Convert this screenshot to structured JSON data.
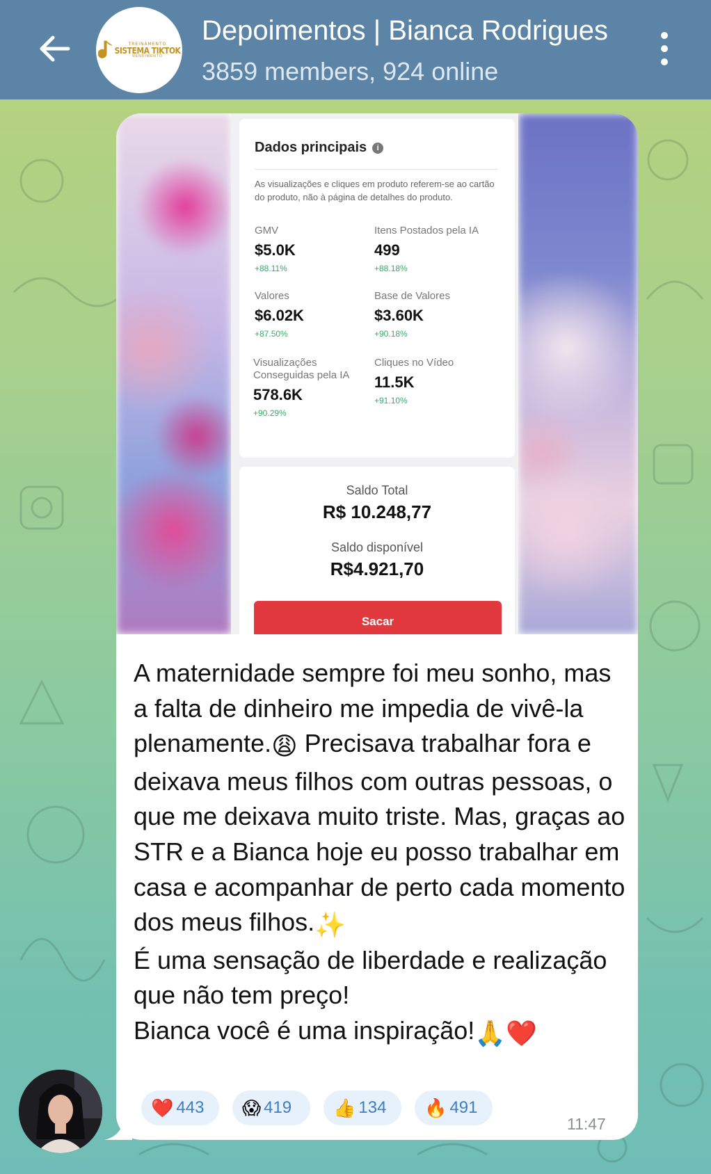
{
  "header": {
    "title": "Depoimentos | Bianca Rodrigues",
    "subtitle": "3859 members, 924 online",
    "logo_small": "TREINAMENTO",
    "logo_main": "SISTEMA TIKTOK",
    "logo_sub": "RENDIMENTO"
  },
  "media": {
    "card_title": "Dados principais",
    "card_description": "As visualizações e cliques em produto referem-se ao cartão do produto, não à página de detalhes do produto.",
    "metrics": [
      {
        "label": "GMV",
        "value": "$5.0K",
        "delta": "+88.11%"
      },
      {
        "label": "Itens Postados pela IA",
        "value": "499",
        "delta": "+88.18%"
      },
      {
        "label": "Valores",
        "value": "$6.02K",
        "delta": "+87.50%"
      },
      {
        "label": "Base de Valores",
        "value": "$3.60K",
        "delta": "+90.18%"
      },
      {
        "label": "Visualizações Conseguidas pela IA",
        "value": "578.6K",
        "delta": "+90.29%"
      },
      {
        "label": "Cliques no Vídeo",
        "value": "11.5K",
        "delta": "+91.10%"
      }
    ],
    "saldo_total_label": "Saldo Total",
    "saldo_total_value": "R$ 10.248,77",
    "saldo_disponivel_label": "Saldo disponível",
    "saldo_disponivel_value": "R$4.921,70",
    "withdraw_label": "Sacar"
  },
  "message": {
    "line1": "A maternidade sempre foi meu sonho, mas a falta de dinheiro me impedia de vivê-la plenamente.",
    "emoji1": "😩",
    "line2": " Precisava trabalhar fora e deixava meus filhos com outras pessoas, o que me deixava muito triste. Mas, graças ao STR e a Bianca hoje eu posso trabalhar em casa e acompanhar de perto cada momento dos meus filhos.",
    "emoji2": "✨",
    "line3": "É uma sensação de liberdade e realização que não tem preço!",
    "line4": "Bianca você é uma inspiração!",
    "emoji3": "🙏❤️",
    "time": "11:47"
  },
  "reactions": [
    {
      "icon": "heart-icon",
      "emoji": "❤️",
      "count": "443"
    },
    {
      "icon": "shocked-face-icon",
      "emoji": "😱",
      "count": "419"
    },
    {
      "icon": "thumbs-up-icon",
      "emoji": "👍",
      "count": "134"
    },
    {
      "icon": "fire-icon",
      "emoji": "🔥",
      "count": "491"
    }
  ],
  "colors": {
    "header": "#5b84a7",
    "accent_red": "#e1393e",
    "delta_green": "#3aa968",
    "reaction_count": "#3d7fc0"
  }
}
